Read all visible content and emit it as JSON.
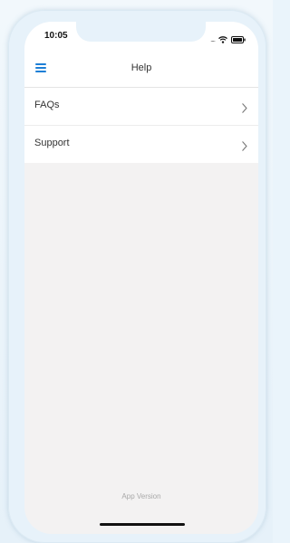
{
  "status_bar": {
    "time": "10:05",
    "signal_dots": "....",
    "wifi_icon": "wifi-icon",
    "battery_icon": "battery-icon"
  },
  "header": {
    "title": "Help",
    "menu_icon": "hamburger-menu-icon"
  },
  "list": {
    "items": [
      {
        "label": "FAQs",
        "icon": "chevron-right-icon"
      },
      {
        "label": "Support",
        "icon": "chevron-right-icon"
      }
    ]
  },
  "footer": {
    "app_version_label": "App Version"
  },
  "colors": {
    "accent": "#1e7fd6",
    "screen_background": "#f3f2f2",
    "text": "#333333",
    "muted_text": "#a8a8a8"
  }
}
